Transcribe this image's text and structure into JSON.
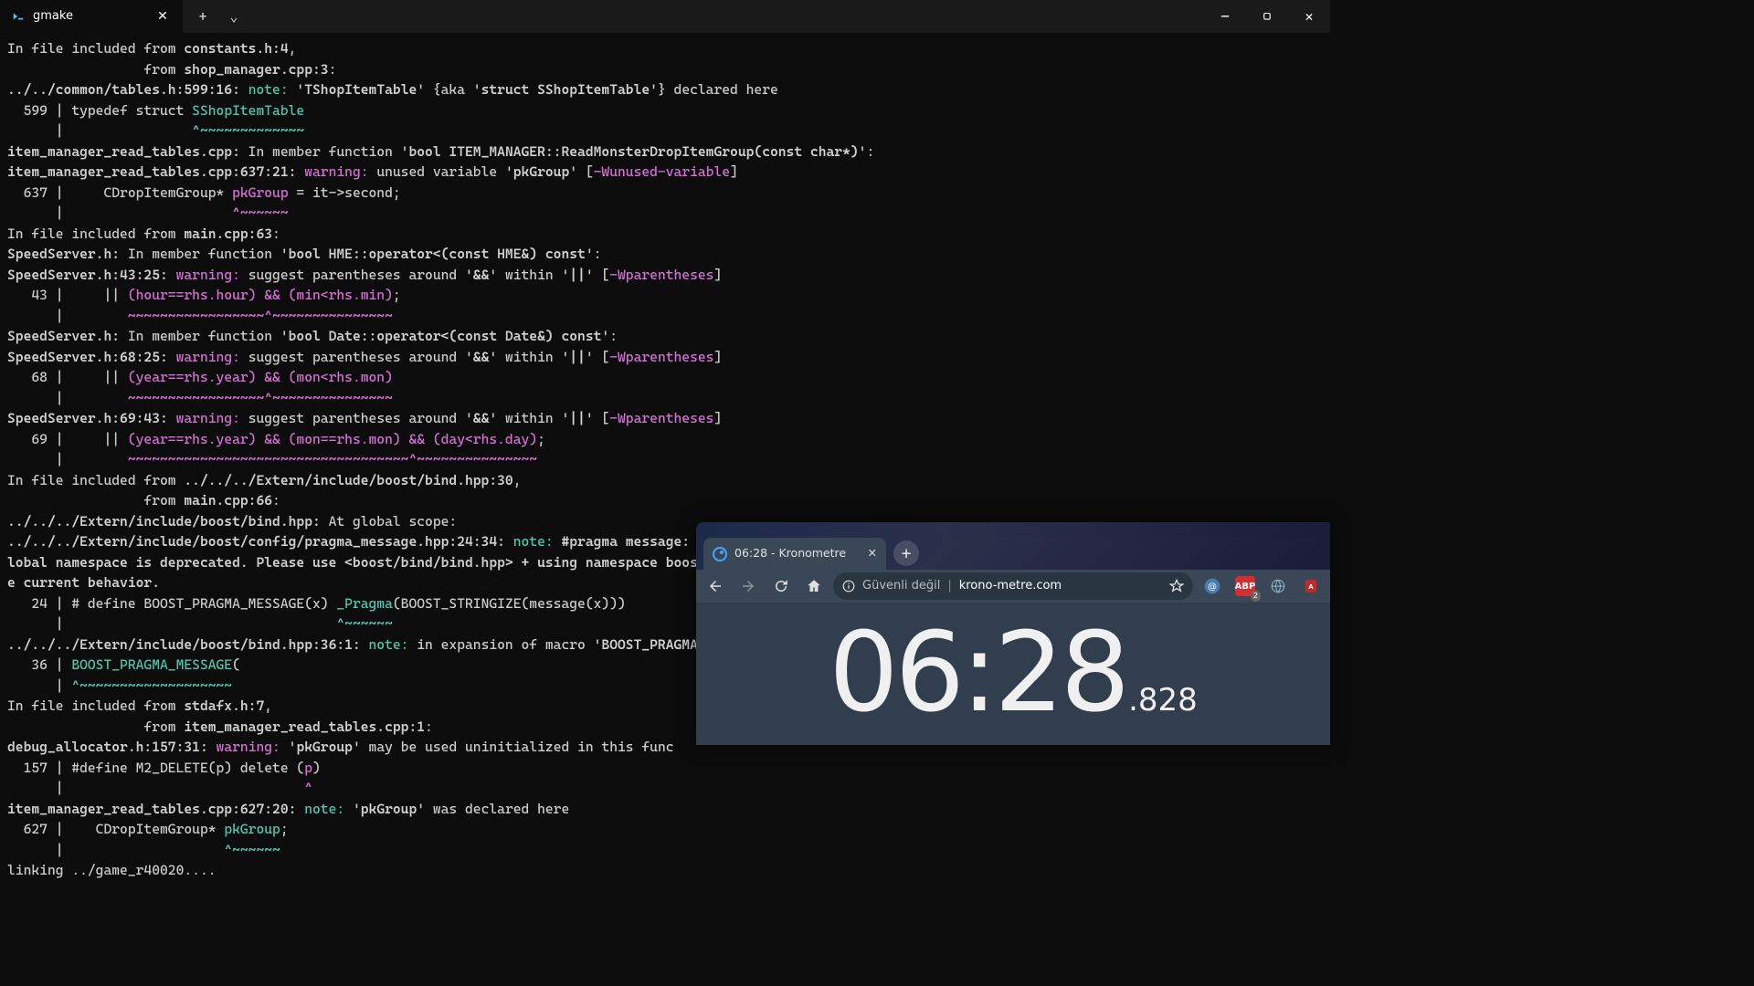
{
  "window": {
    "tab_title": "gmake",
    "new_tab_glyph": "+",
    "chevron_glyph": "⌄",
    "minimize": "—",
    "maximize": "▢",
    "close": "✕"
  },
  "terminal": {
    "lines": [
      [
        {
          "c": "c-dim",
          "t": "In file included from "
        },
        {
          "c": "c-w",
          "t": "constants.h:4"
        },
        {
          "c": "c-dim",
          "t": ","
        }
      ],
      [
        {
          "c": "c-dim",
          "t": "                 from "
        },
        {
          "c": "c-w",
          "t": "shop_manager.cpp:3"
        },
        {
          "c": "c-dim",
          "t": ":"
        }
      ],
      [
        {
          "c": "c-w",
          "t": "../../common/tables.h:599:16:"
        },
        {
          "c": "c-dim",
          "t": " "
        },
        {
          "c": "c-note",
          "t": "note: "
        },
        {
          "c": "c-dim",
          "t": "'"
        },
        {
          "c": "c-w",
          "t": "TShopItemTable"
        },
        {
          "c": "c-dim",
          "t": "' {aka '"
        },
        {
          "c": "c-w",
          "t": "struct SShopItemTable"
        },
        {
          "c": "c-dim",
          "t": "'} declared here"
        }
      ],
      [
        {
          "c": "c-dim",
          "t": "  599 | typedef struct "
        },
        {
          "c": "c-cyan",
          "t": "SShopItemTable"
        }
      ],
      [
        {
          "c": "c-dim",
          "t": "      |                "
        },
        {
          "c": "c-cyan",
          "t": "^~~~~~~~~~~~~~"
        }
      ],
      [
        {
          "c": "c-w",
          "t": "item_manager_read_tables.cpp:"
        },
        {
          "c": "c-dim",
          "t": " In member function '"
        },
        {
          "c": "c-w",
          "t": "bool ITEM_MANAGER::ReadMonsterDropItemGroup(const char*)"
        },
        {
          "c": "c-dim",
          "t": "':"
        }
      ],
      [
        {
          "c": "c-w",
          "t": "item_manager_read_tables.cpp:637:21:"
        },
        {
          "c": "c-dim",
          "t": " "
        },
        {
          "c": "c-warn",
          "t": "warning: "
        },
        {
          "c": "c-dim",
          "t": "unused variable '"
        },
        {
          "c": "c-w",
          "t": "pkGroup"
        },
        {
          "c": "c-dim",
          "t": "' ["
        },
        {
          "c": "c-warn",
          "t": "-Wunused-variable"
        },
        {
          "c": "c-dim",
          "t": "]"
        }
      ],
      [
        {
          "c": "c-dim",
          "t": "  637 |     CDropItemGroup* "
        },
        {
          "c": "c-mag",
          "t": "pkGroup"
        },
        {
          "c": "c-dim",
          "t": " = it->second;"
        }
      ],
      [
        {
          "c": "c-dim",
          "t": "      |                     "
        },
        {
          "c": "c-mag",
          "t": "^~~~~~~"
        }
      ],
      [
        {
          "c": "c-dim",
          "t": "In file included from "
        },
        {
          "c": "c-w",
          "t": "main.cpp:63"
        },
        {
          "c": "c-dim",
          "t": ":"
        }
      ],
      [
        {
          "c": "c-w",
          "t": "SpeedServer.h:"
        },
        {
          "c": "c-dim",
          "t": " In member function '"
        },
        {
          "c": "c-w",
          "t": "bool HME::operator<(const HME&) const"
        },
        {
          "c": "c-dim",
          "t": "':"
        }
      ],
      [
        {
          "c": "c-w",
          "t": "SpeedServer.h:43:25:"
        },
        {
          "c": "c-dim",
          "t": " "
        },
        {
          "c": "c-warn",
          "t": "warning: "
        },
        {
          "c": "c-dim",
          "t": "suggest parentheses around '"
        },
        {
          "c": "c-w",
          "t": "&&"
        },
        {
          "c": "c-dim",
          "t": "' within '"
        },
        {
          "c": "c-w",
          "t": "||"
        },
        {
          "c": "c-dim",
          "t": "' ["
        },
        {
          "c": "c-warn",
          "t": "-Wparentheses"
        },
        {
          "c": "c-dim",
          "t": "]"
        }
      ],
      [
        {
          "c": "c-dim",
          "t": "   43 |     || "
        },
        {
          "c": "c-mag",
          "t": "(hour==rhs.hour) && (min<rhs.min)"
        },
        {
          "c": "c-dim",
          "t": ";"
        }
      ],
      [
        {
          "c": "c-dim",
          "t": "      |        "
        },
        {
          "c": "c-mag",
          "t": "~~~~~~~~~~~~~~~~~^~~~~~~~~~~~~~~~"
        }
      ],
      [
        {
          "c": "c-w",
          "t": "SpeedServer.h:"
        },
        {
          "c": "c-dim",
          "t": " In member function '"
        },
        {
          "c": "c-w",
          "t": "bool Date::operator<(const Date&) const"
        },
        {
          "c": "c-dim",
          "t": "':"
        }
      ],
      [
        {
          "c": "c-w",
          "t": "SpeedServer.h:68:25:"
        },
        {
          "c": "c-dim",
          "t": " "
        },
        {
          "c": "c-warn",
          "t": "warning: "
        },
        {
          "c": "c-dim",
          "t": "suggest parentheses around '"
        },
        {
          "c": "c-w",
          "t": "&&"
        },
        {
          "c": "c-dim",
          "t": "' within '"
        },
        {
          "c": "c-w",
          "t": "||"
        },
        {
          "c": "c-dim",
          "t": "' ["
        },
        {
          "c": "c-warn",
          "t": "-Wparentheses"
        },
        {
          "c": "c-dim",
          "t": "]"
        }
      ],
      [
        {
          "c": "c-dim",
          "t": "   68 |     || "
        },
        {
          "c": "c-mag",
          "t": "(year==rhs.year) && (mon<rhs.mon)"
        }
      ],
      [
        {
          "c": "c-dim",
          "t": "      |        "
        },
        {
          "c": "c-mag",
          "t": "~~~~~~~~~~~~~~~~~^~~~~~~~~~~~~~~~"
        }
      ],
      [
        {
          "c": "c-w",
          "t": "SpeedServer.h:69:43:"
        },
        {
          "c": "c-dim",
          "t": " "
        },
        {
          "c": "c-warn",
          "t": "warning: "
        },
        {
          "c": "c-dim",
          "t": "suggest parentheses around '"
        },
        {
          "c": "c-w",
          "t": "&&"
        },
        {
          "c": "c-dim",
          "t": "' within '"
        },
        {
          "c": "c-w",
          "t": "||"
        },
        {
          "c": "c-dim",
          "t": "' ["
        },
        {
          "c": "c-warn",
          "t": "-Wparentheses"
        },
        {
          "c": "c-dim",
          "t": "]"
        }
      ],
      [
        {
          "c": "c-dim",
          "t": "   69 |     || "
        },
        {
          "c": "c-mag",
          "t": "(year==rhs.year) && (mon==rhs.mon) && (day<rhs.day)"
        },
        {
          "c": "c-dim",
          "t": ";"
        }
      ],
      [
        {
          "c": "c-dim",
          "t": "      |        "
        },
        {
          "c": "c-mag",
          "t": "~~~~~~~~~~~~~~~~~~~~~~~~~~~~~~~~~~~^~~~~~~~~~~~~~~~"
        }
      ],
      [
        {
          "c": "c-dim",
          "t": "In file included from "
        },
        {
          "c": "c-w",
          "t": "../../../Extern/include/boost/bind.hpp:30"
        },
        {
          "c": "c-dim",
          "t": ","
        }
      ],
      [
        {
          "c": "c-dim",
          "t": "                 from "
        },
        {
          "c": "c-w",
          "t": "main.cpp:66"
        },
        {
          "c": "c-dim",
          "t": ":"
        }
      ],
      [
        {
          "c": "c-w",
          "t": "../../../Extern/include/boost/bind.hpp:"
        },
        {
          "c": "c-dim",
          "t": " At global scope:"
        }
      ],
      [
        {
          "c": "c-w",
          "t": "../../../Extern/include/boost/config/pragma_message.hpp:24:34:"
        },
        {
          "c": "c-dim",
          "t": " "
        },
        {
          "c": "c-note",
          "t": "note: "
        },
        {
          "c": "c-w",
          "t": "#pragma message: The practice of declaring the Bind placeholders (_1, _2, ...) in the g"
        }
      ],
      [
        {
          "c": "c-w",
          "t": "lobal namespace is deprecated. Please use <boost/bind/bind.hpp> + using namespace boost::placeholders, or define BOOST_BIND_GLOBAL_PLACEHOLDERS to retain th"
        }
      ],
      [
        {
          "c": "c-w",
          "t": "e current behavior."
        }
      ],
      [
        {
          "c": "c-dim",
          "t": "   24 | # define BOOST_PRAGMA_MESSAGE(x) "
        },
        {
          "c": "c-cyan",
          "t": "_Pragma"
        },
        {
          "c": "c-dim",
          "t": "(BOOST_STRINGIZE(message(x)))"
        }
      ],
      [
        {
          "c": "c-dim",
          "t": "      |                                  "
        },
        {
          "c": "c-cyan",
          "t": "^~~~~~~"
        }
      ],
      [
        {
          "c": "c-w",
          "t": "../../../Extern/include/boost/bind.hpp:36:1:"
        },
        {
          "c": "c-dim",
          "t": " "
        },
        {
          "c": "c-note",
          "t": "note: "
        },
        {
          "c": "c-dim",
          "t": "in expansion of macro '"
        },
        {
          "c": "c-w",
          "t": "BOOST_PRAGMA_MESSAGE"
        },
        {
          "c": "c-dim",
          "t": "'"
        }
      ],
      [
        {
          "c": "c-dim",
          "t": "   36 | "
        },
        {
          "c": "c-cyan",
          "t": "BOOST_PRAGMA_MESSAGE"
        },
        {
          "c": "c-dim",
          "t": "("
        }
      ],
      [
        {
          "c": "c-dim",
          "t": "      | "
        },
        {
          "c": "c-cyan",
          "t": "^~~~~~~~~~~~~~~~~~~~"
        }
      ],
      [
        {
          "c": "c-dim",
          "t": "In file included from "
        },
        {
          "c": "c-w",
          "t": "stdafx.h:7"
        },
        {
          "c": "c-dim",
          "t": ","
        }
      ],
      [
        {
          "c": "c-dim",
          "t": "                 from "
        },
        {
          "c": "c-w",
          "t": "item_manager_read_tables.cpp:1"
        },
        {
          "c": "c-dim",
          "t": ":"
        }
      ],
      [
        {
          "c": "c-w",
          "t": "debug_allocator.h:157:31:"
        },
        {
          "c": "c-dim",
          "t": " "
        },
        {
          "c": "c-warn",
          "t": "warning: "
        },
        {
          "c": "c-dim",
          "t": "'"
        },
        {
          "c": "c-w",
          "t": "pkGroup"
        },
        {
          "c": "c-dim",
          "t": "' may be used uninitialized in this func"
        }
      ],
      [
        {
          "c": "c-dim",
          "t": "  157 | #define M2_DELETE(p) delete ("
        },
        {
          "c": "c-mag",
          "t": "p"
        },
        {
          "c": "c-dim",
          "t": ")"
        }
      ],
      [
        {
          "c": "c-dim",
          "t": "      |                              "
        },
        {
          "c": "c-mag",
          "t": "^"
        }
      ],
      [
        {
          "c": "c-w",
          "t": "item_manager_read_tables.cpp:627:20:"
        },
        {
          "c": "c-dim",
          "t": " "
        },
        {
          "c": "c-note",
          "t": "note: "
        },
        {
          "c": "c-dim",
          "t": "'"
        },
        {
          "c": "c-w",
          "t": "pkGroup"
        },
        {
          "c": "c-dim",
          "t": "' was declared here"
        }
      ],
      [
        {
          "c": "c-dim",
          "t": "  627 |    CDropItemGroup* "
        },
        {
          "c": "c-cyan",
          "t": "pkGroup"
        },
        {
          "c": "c-dim",
          "t": ";"
        }
      ],
      [
        {
          "c": "c-dim",
          "t": "      |                    "
        },
        {
          "c": "c-cyan",
          "t": "^~~~~~~"
        }
      ],
      [
        {
          "c": "c-dim",
          "t": "linking ../game_r40020...."
        }
      ]
    ]
  },
  "browser": {
    "tab_title": "06:28 - Kronometre",
    "tab_close": "✕",
    "new_tab": "+",
    "security_text": "Güvenli değil",
    "divider": "|",
    "domain": "krono-metre.com",
    "abp_label": "ABP",
    "abp_count": "2",
    "timer_main": "06:28",
    "timer_ms": ".828"
  }
}
